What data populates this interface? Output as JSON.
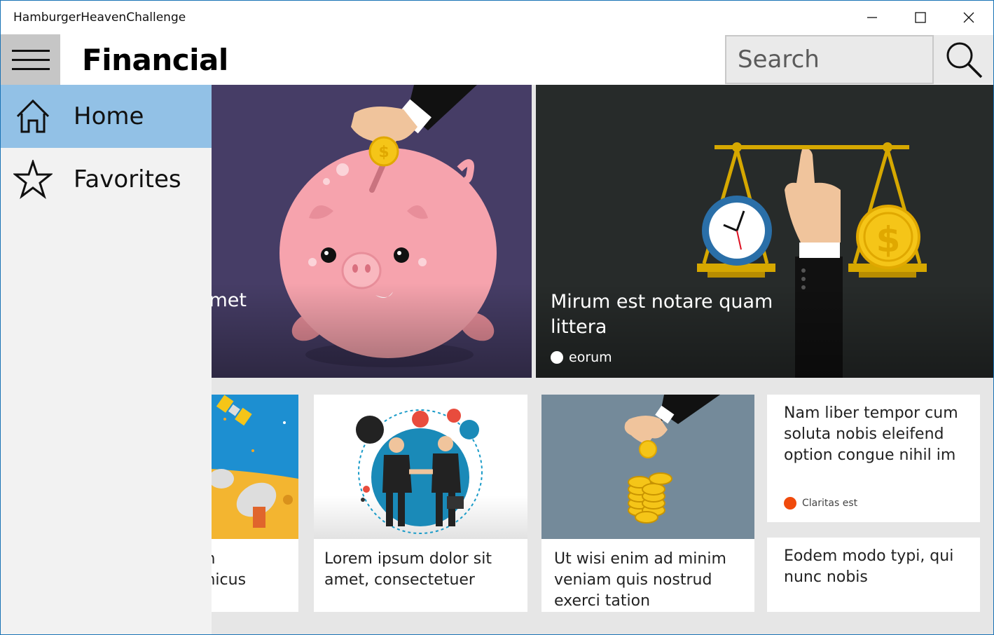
{
  "window": {
    "title": "HamburgerHeavenChallenge",
    "controls": {
      "minimize": "minimize-icon",
      "maximize": "maximize-icon",
      "close": "close-icon"
    }
  },
  "header": {
    "menu_icon": "hamburger-menu-icon",
    "title": "Financial",
    "search_placeholder": "Search",
    "search_icon": "search-icon"
  },
  "nav": {
    "items": [
      {
        "label": "Home",
        "icon": "home-icon",
        "selected": true
      },
      {
        "label": "Favorites",
        "icon": "star-icon",
        "selected": false
      }
    ]
  },
  "hero": [
    {
      "title": "olor sit amet",
      "image": "piggy-bank-illustration"
    },
    {
      "title": "Mirum est notare quam littera",
      "meta": "eorum",
      "meta_color": "#ffffff",
      "image": "scale-clock-coin-illustration"
    }
  ],
  "cards": [
    {
      "title_lines": [
        "m",
        "micus"
      ],
      "image": "satellite-dish-illustration"
    },
    {
      "title": "Lorem ipsum dolor sit amet, consectetuer",
      "image": "business-handshake-illustration"
    },
    {
      "title": "Ut wisi enim ad minim veniam quis nostrud exerci tation",
      "image": "coin-stack-illustration"
    },
    {
      "title": "Nam liber tempor cum soluta nobis eleifend option congue nihil im",
      "meta": "Claritas est",
      "meta_color": "#f04a0c"
    },
    {
      "title": "Eodem modo typi, qui nunc nobis"
    }
  ],
  "colors": {
    "accent_selected": "#92c1e6",
    "nav_background": "#f2f2f2",
    "hamburger_background": "#c6c6c6",
    "hero_left_bg": "#463d66",
    "hero_right_bg": "#272b2a"
  }
}
